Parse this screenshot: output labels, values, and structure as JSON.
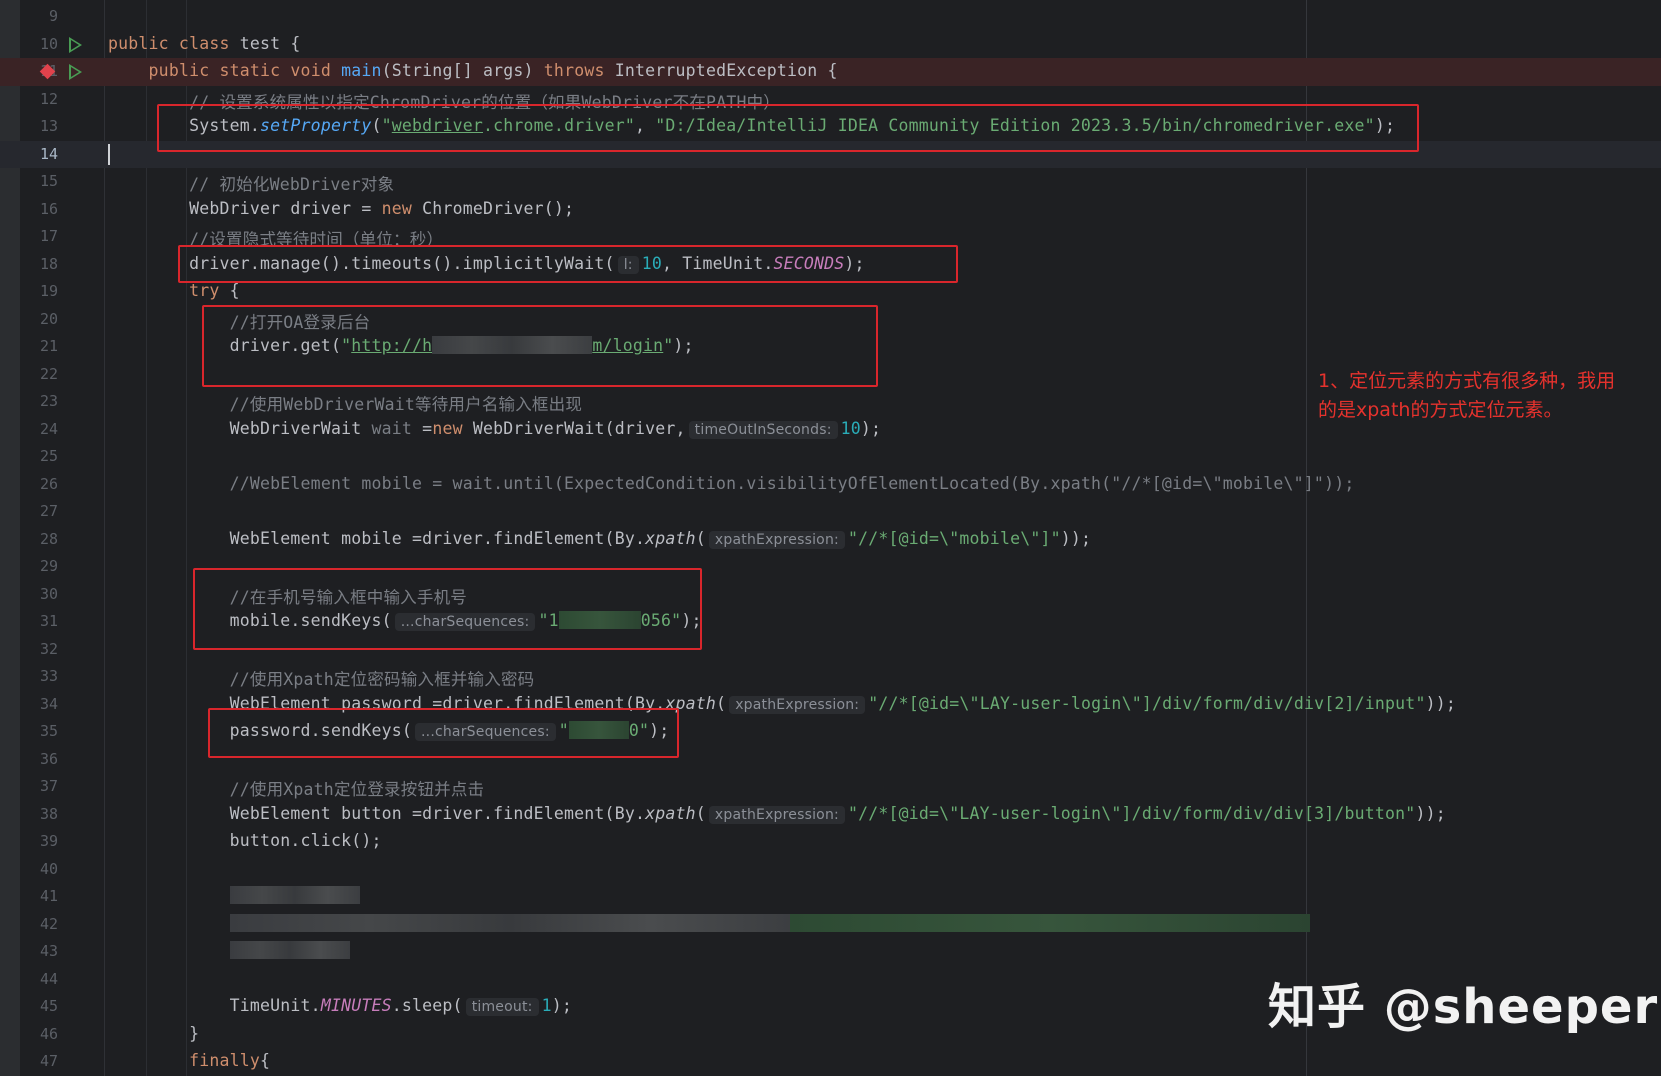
{
  "editor": {
    "lines": [
      {
        "num": "9",
        "parts": []
      },
      {
        "num": "10",
        "gutter": "run",
        "parts": [
          [
            "kw",
            "public class "
          ],
          [
            "",
            "test {"
          ]
        ]
      },
      {
        "num": "11",
        "gutter": "breakpoint-run",
        "highlight": "break",
        "parts": [
          [
            "",
            "    "
          ],
          [
            "kw",
            "public static void "
          ],
          [
            "fn",
            "main"
          ],
          [
            "",
            "(String[] args) "
          ],
          [
            "kw",
            "throws "
          ],
          [
            "",
            "InterruptedException {"
          ]
        ]
      },
      {
        "num": "12",
        "parts": [
          [
            "",
            "        "
          ],
          [
            "cm",
            "// 设置系统属性以指定ChromDriver的位置（如果WebDriver不在PATH中）"
          ]
        ]
      },
      {
        "num": "13",
        "parts": [
          [
            "",
            "        System."
          ],
          [
            "fn it",
            "setProperty"
          ],
          [
            "",
            "("
          ],
          [
            "str",
            "\""
          ],
          [
            "str ul",
            "webdriver"
          ],
          [
            "str",
            ".chrome.driver\""
          ],
          [
            "",
            ", "
          ],
          [
            "str",
            "\"D:/Idea/IntelliJ IDEA Community Edition 2023.3.5/bin/chromedriver.exe\""
          ],
          [
            "",
            ");"
          ]
        ]
      },
      {
        "num": "14",
        "highlight": "current",
        "caret": true,
        "parts": []
      },
      {
        "num": "15",
        "parts": [
          [
            "",
            "        "
          ],
          [
            "cm",
            "// 初始化WebDriver对象"
          ]
        ]
      },
      {
        "num": "16",
        "parts": [
          [
            "",
            "        WebDriver driver = "
          ],
          [
            "kw",
            "new "
          ],
          [
            "",
            "ChromeDriver();"
          ]
        ]
      },
      {
        "num": "17",
        "parts": [
          [
            "",
            "        "
          ],
          [
            "cm",
            "//设置隐式等待时间（单位：秒）"
          ]
        ]
      },
      {
        "num": "18",
        "parts": [
          [
            "",
            "        driver.manage().timeouts().implicitlyWait("
          ],
          [
            "hint",
            "l:"
          ],
          [
            "num",
            "10"
          ],
          [
            "",
            ", TimeUnit."
          ],
          [
            "cst",
            "SECONDS"
          ],
          [
            "",
            ");"
          ]
        ]
      },
      {
        "num": "19",
        "parts": [
          [
            "",
            "        "
          ],
          [
            "kw",
            "try "
          ],
          [
            "",
            "{"
          ]
        ]
      },
      {
        "num": "20",
        "parts": [
          [
            "",
            "            "
          ],
          [
            "cm",
            "//打开OA登录后台"
          ]
        ]
      },
      {
        "num": "21",
        "parts": [
          [
            "",
            "            driver.get("
          ],
          [
            "str",
            "\""
          ],
          [
            "str ul",
            "http://h"
          ],
          [
            "blur",
            "160"
          ],
          [
            "str ul",
            "m/login"
          ],
          [
            "str",
            "\""
          ],
          [
            "",
            ");"
          ]
        ]
      },
      {
        "num": "22",
        "parts": []
      },
      {
        "num": "23",
        "parts": [
          [
            "",
            "            "
          ],
          [
            "cm",
            "//使用WebDriverWait等待用户名输入框出现"
          ]
        ]
      },
      {
        "num": "24",
        "parts": [
          [
            "",
            "            WebDriverWait "
          ],
          [
            "cm",
            "wait"
          ],
          [
            "",
            " ="
          ],
          [
            "kw",
            "new "
          ],
          [
            "",
            "WebDriverWait(driver,"
          ],
          [
            "hint",
            "timeOutInSeconds:"
          ],
          [
            "num",
            "10"
          ],
          [
            "",
            ");"
          ]
        ]
      },
      {
        "num": "25",
        "parts": []
      },
      {
        "num": "26",
        "parts": [
          [
            "",
            "            "
          ],
          [
            "cm",
            "//WebElement mobile = wait.until(ExpectedCondition.visibilityOfElementLocated(By.xpath(\"//*[@id=\\\"mobile\\\"]\"));"
          ]
        ]
      },
      {
        "num": "27",
        "parts": []
      },
      {
        "num": "28",
        "parts": [
          [
            "",
            "            WebElement mobile =driver.findElement(By."
          ],
          [
            "it",
            "xpath"
          ],
          [
            "",
            "("
          ],
          [
            "hint",
            "xpathExpression:"
          ],
          [
            "str",
            "\"//*[@id=\\\"mobile\\\"]\""
          ],
          [
            "",
            "));"
          ]
        ]
      },
      {
        "num": "29",
        "parts": []
      },
      {
        "num": "30",
        "parts": [
          [
            "",
            "            "
          ],
          [
            "cm",
            "//在手机号输入框中输入手机号"
          ]
        ]
      },
      {
        "num": "31",
        "parts": [
          [
            "",
            "            mobile.sendKeys("
          ],
          [
            "hint",
            "...charSequences:"
          ],
          [
            "str",
            "\"1"
          ],
          [
            "blur g",
            "82"
          ],
          [
            "str",
            "056\""
          ],
          [
            "",
            ");"
          ]
        ]
      },
      {
        "num": "32",
        "parts": []
      },
      {
        "num": "33",
        "parts": [
          [
            "",
            "            "
          ],
          [
            "cm",
            "//使用Xpath定位密码输入框并输入密码"
          ]
        ]
      },
      {
        "num": "34",
        "parts": [
          [
            "",
            "            WebElement password =driver.findElement(By."
          ],
          [
            "it",
            "xpath"
          ],
          [
            "",
            "("
          ],
          [
            "hint",
            "xpathExpression:"
          ],
          [
            "str",
            "\"//*[@id=\\\"LAY-user-login\\\"]/div/form/div/div[2]/input\""
          ],
          [
            "",
            "));"
          ]
        ]
      },
      {
        "num": "35",
        "parts": [
          [
            "",
            "            password.sendKeys("
          ],
          [
            "hint",
            "...charSequences:"
          ],
          [
            "str",
            "\""
          ],
          [
            "blur g",
            "60"
          ],
          [
            "str",
            "0\""
          ],
          [
            "",
            ");"
          ]
        ]
      },
      {
        "num": "36",
        "parts": []
      },
      {
        "num": "37",
        "parts": [
          [
            "",
            "            "
          ],
          [
            "cm",
            "//使用Xpath定位登录按钮并点击"
          ]
        ]
      },
      {
        "num": "38",
        "parts": [
          [
            "",
            "            WebElement button =driver.findElement(By."
          ],
          [
            "it",
            "xpath"
          ],
          [
            "",
            "("
          ],
          [
            "hint",
            "xpathExpression:"
          ],
          [
            "str",
            "\"//*[@id=\\\"LAY-user-login\\\"]/div/form/div/div[3]/button\""
          ],
          [
            "",
            "));"
          ]
        ]
      },
      {
        "num": "39",
        "parts": [
          [
            "",
            "            button.click();"
          ]
        ]
      },
      {
        "num": "40",
        "parts": []
      },
      {
        "num": "41",
        "parts": [
          [
            "",
            "            "
          ],
          [
            "blur",
            "130"
          ]
        ]
      },
      {
        "num": "42",
        "parts": [
          [
            "",
            "            "
          ],
          [
            "blur",
            "560"
          ],
          [
            "blur g",
            "520"
          ]
        ]
      },
      {
        "num": "43",
        "parts": [
          [
            "",
            "            "
          ],
          [
            "blur",
            "120"
          ]
        ]
      },
      {
        "num": "44",
        "parts": []
      },
      {
        "num": "45",
        "parts": [
          [
            "",
            "            TimeUnit."
          ],
          [
            "cst",
            "MINUTES"
          ],
          [
            "",
            ".sleep("
          ],
          [
            "hint",
            "timeout:"
          ],
          [
            "num",
            "1"
          ],
          [
            "",
            ");"
          ]
        ]
      },
      {
        "num": "46",
        "parts": [
          [
            "",
            "        }"
          ]
        ]
      },
      {
        "num": "47",
        "parts": [
          [
            "",
            "        "
          ],
          [
            "kw",
            "finally"
          ],
          [
            "",
            "{"
          ]
        ]
      }
    ]
  },
  "annotation": "1、定位元素的方式有很多种，我用的是xpath的方式定位元素。",
  "watermark": "知乎 @sheeper",
  "colors": {
    "background": "#1e1f22",
    "keyword": "#cf8e6d",
    "function": "#56a8f5",
    "string": "#6aab73",
    "number": "#2aacb8",
    "comment": "#7a7e85",
    "constant": "#c77dbb",
    "annotation_box": "#d9262c",
    "annotation_text": "#e5322d"
  }
}
